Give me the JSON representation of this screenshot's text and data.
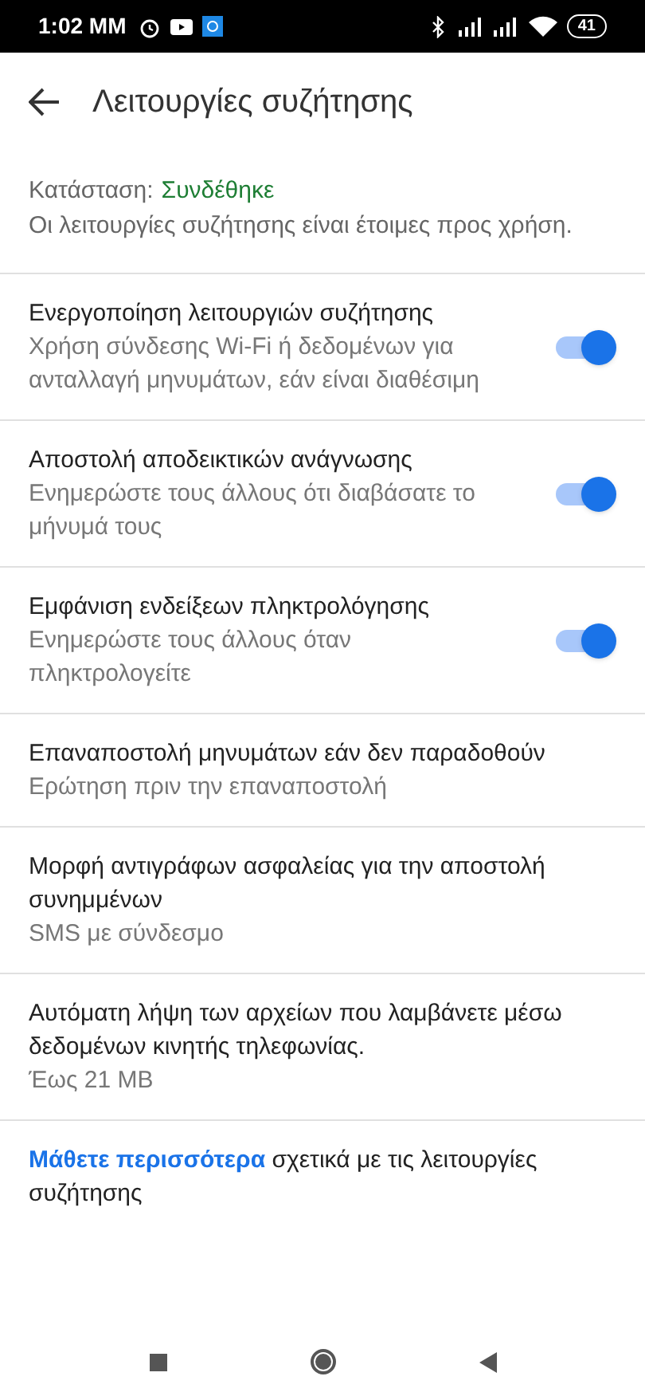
{
  "status_bar": {
    "time": "1:02 MM",
    "battery": "41"
  },
  "header": {
    "title": "Λειτουργίες συζήτησης"
  },
  "status": {
    "label": "Κατάσταση:",
    "value": "Συνδέθηκε",
    "description": "Οι λειτουργίες συζήτησης είναι έτοιμες προς χρήση."
  },
  "settings": [
    {
      "kind": "toggle",
      "title": "Ενεργοποίηση λειτουργιών συζήτησης",
      "subtitle": "Χρήση σύνδεσης Wi-Fi ή δεδομένων για ανταλλαγή μηνυμάτων, εάν είναι διαθέσιμη",
      "on": true
    },
    {
      "kind": "toggle",
      "title": "Αποστολή αποδεικτικών ανάγνωσης",
      "subtitle": "Ενημερώστε τους άλλους ότι διαβάσατε το μήνυμά τους",
      "on": true
    },
    {
      "kind": "toggle",
      "title": "Εμφάνιση ενδείξεων πληκτρολόγησης",
      "subtitle": "Ενημερώστε τους άλλους όταν πληκτρολογείτε",
      "on": true
    },
    {
      "kind": "option",
      "title": "Επαναποστολή μηνυμάτων εάν δεν παραδοθούν",
      "subtitle": "Ερώτηση πριν την επαναποστολή"
    },
    {
      "kind": "option",
      "title": "Μορφή αντιγράφων ασφαλείας για την αποστολή συνημμένων",
      "subtitle": "SMS με σύνδεσμο"
    },
    {
      "kind": "option",
      "title": "Αυτόματη λήψη των αρχείων που λαμβάνετε μέσω δεδομένων κινητής τηλεφωνίας.",
      "subtitle": "Έως 21 MB"
    }
  ],
  "footer": {
    "link": "Μάθετε περισσότερα",
    "text": "σχετικά με τις λειτουργίες συζήτησης"
  }
}
